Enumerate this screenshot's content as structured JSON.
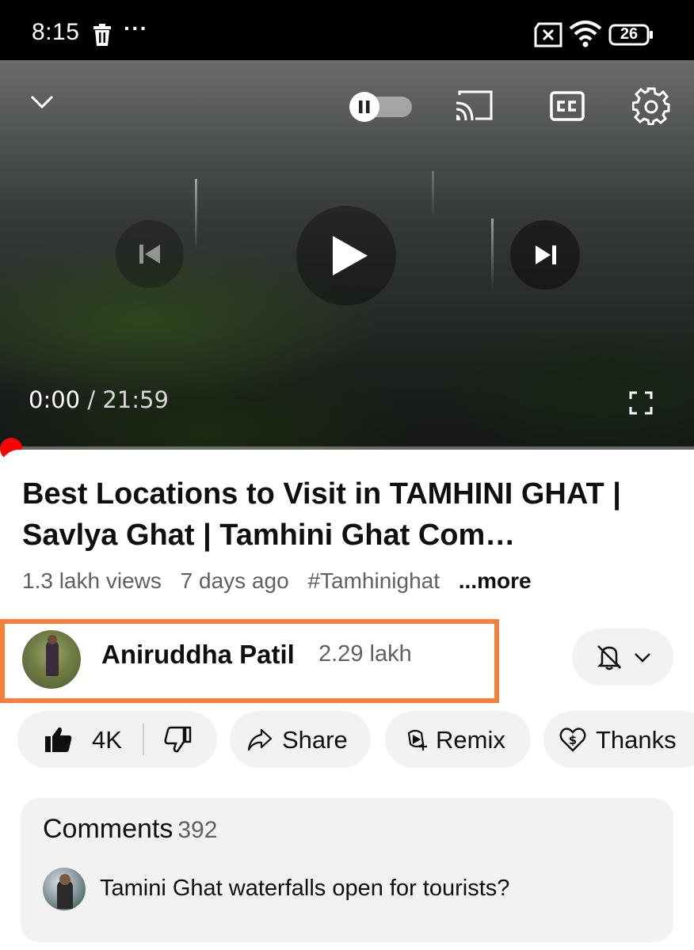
{
  "status_bar": {
    "time": "8:15",
    "more_dots": "···",
    "battery": "26",
    "icons": [
      "trash-icon",
      "sim-x-icon",
      "wifi-icon",
      "battery-icon"
    ]
  },
  "player": {
    "current_time": "0:00",
    "separator": " / ",
    "duration": "21:59",
    "progress": 0.0,
    "icons": [
      "chevron-down-icon",
      "autoplay-toggle",
      "cast-icon",
      "cc-icon",
      "gear-icon",
      "previous-icon",
      "play-icon",
      "next-icon",
      "fullscreen-icon"
    ]
  },
  "video": {
    "title": "Best Locations to Visit in TAMHINI GHAT | Savlya Ghat | Tamhini Ghat Com…",
    "views": "1.3 lakh views",
    "age": "7 days ago",
    "hashtag": "#Tamhinighat",
    "more": "...more"
  },
  "channel": {
    "name": "Aniruddha Patil",
    "subscribers": "2.29 lakh",
    "highlight_color": "#f5803e"
  },
  "actions": {
    "likes": "4K",
    "share": "Share",
    "remix": "Remix",
    "thanks": "Thanks"
  },
  "comments": {
    "heading": "Comments",
    "count": "392",
    "top_comment": "Tamini Ghat waterfalls open for tourists?"
  },
  "colors": {
    "accent_red": "#ff0000",
    "pill_bg": "#f2f2f2",
    "secondary_text": "#606060"
  }
}
